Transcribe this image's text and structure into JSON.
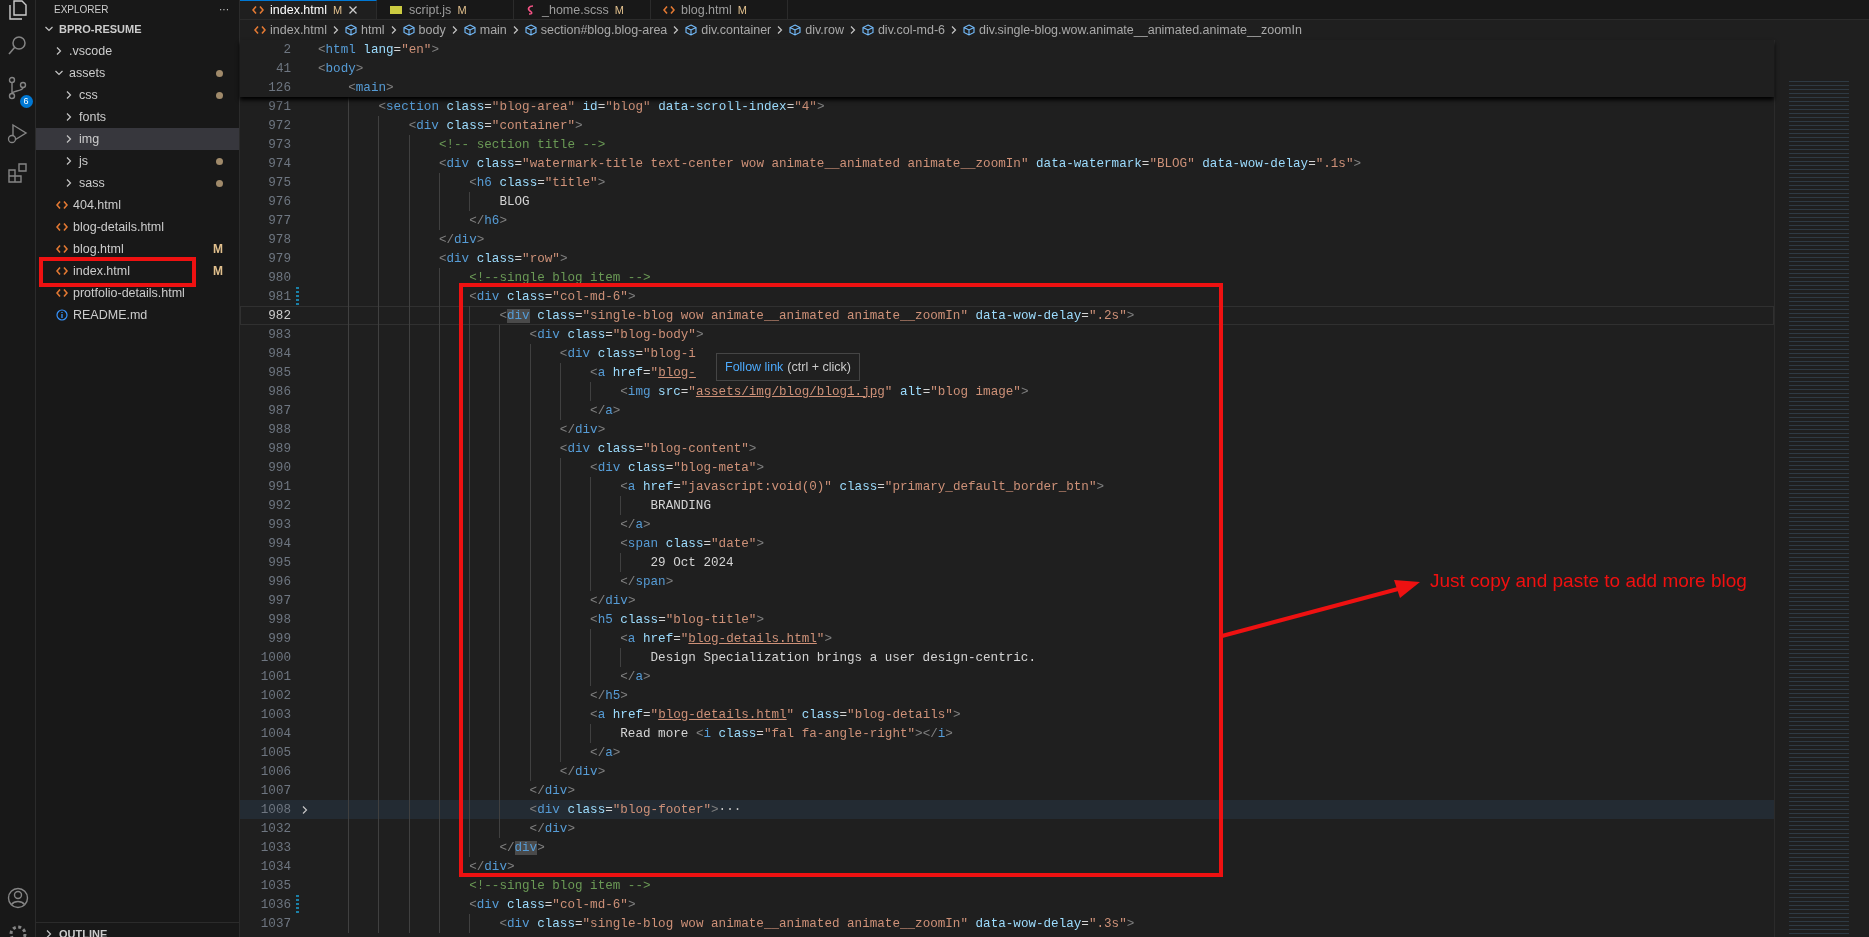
{
  "activity_bar": {
    "source_control_badge": "6"
  },
  "sidebar": {
    "title": "EXPLORER",
    "more": "···",
    "tree": [
      {
        "name": "BPRO-RESUME",
        "kind": "root",
        "expanded": true,
        "selected": false,
        "modified": false,
        "children": [
          {
            "name": ".vscode",
            "kind": "folder",
            "expanded": false,
            "selected": false,
            "modified": false
          },
          {
            "name": "assets",
            "kind": "folder",
            "expanded": true,
            "selected": false,
            "modified": true,
            "children": [
              {
                "name": "css",
                "kind": "folder",
                "expanded": false,
                "selected": false,
                "modified": true
              },
              {
                "name": "fonts",
                "kind": "folder",
                "expanded": false,
                "selected": false,
                "modified": false
              },
              {
                "name": "img",
                "kind": "folder",
                "expanded": false,
                "selected": true,
                "modified": false
              },
              {
                "name": "js",
                "kind": "folder",
                "expanded": false,
                "selected": false,
                "modified": true
              },
              {
                "name": "sass",
                "kind": "folder",
                "expanded": false,
                "selected": false,
                "modified": true
              }
            ]
          },
          {
            "name": "404.html",
            "kind": "html",
            "selected": false,
            "modified": false
          },
          {
            "name": "blog-details.html",
            "kind": "html",
            "selected": false,
            "modified": false
          },
          {
            "name": "blog.html",
            "kind": "html",
            "selected": false,
            "modified": true,
            "badge": "M"
          },
          {
            "name": "index.html",
            "kind": "html",
            "selected": false,
            "modified": true,
            "badge": "M"
          },
          {
            "name": "protfolio-details.html",
            "kind": "html",
            "selected": false,
            "modified": false
          },
          {
            "name": "README.md",
            "kind": "info",
            "selected": false,
            "modified": false
          }
        ]
      }
    ],
    "outline": {
      "label": "OUTLINE",
      "expanded": false
    }
  },
  "tabs": [
    {
      "label": "index.html",
      "badge": "M",
      "kind": "html",
      "selected": true
    },
    {
      "label": "script.js",
      "badge": "M",
      "kind": "js",
      "selected": false
    },
    {
      "label": "_home.scss",
      "badge": "M",
      "kind": "scss",
      "selected": false
    },
    {
      "label": "blog.html",
      "badge": "M",
      "kind": "html",
      "selected": false
    }
  ],
  "breadcrumbs": [
    {
      "label": "index.html",
      "kind": "file"
    },
    {
      "label": "html",
      "kind": "element"
    },
    {
      "label": "body",
      "kind": "element"
    },
    {
      "label": "main",
      "kind": "element"
    },
    {
      "label": "section#blog.blog-area",
      "kind": "element"
    },
    {
      "label": "div.container",
      "kind": "element"
    },
    {
      "label": "div.row",
      "kind": "element"
    },
    {
      "label": "div.col-md-6",
      "kind": "element"
    },
    {
      "label": "div.single-blog.wow.animate__animated.animate__zoomIn",
      "kind": "element"
    }
  ],
  "sticky_lines": [
    {
      "number": "2",
      "tokens": [
        {
          "kind": "tag",
          "text": "<html"
        },
        {
          "kind": "attr",
          "text": " lang="
        },
        {
          "kind": "string",
          "text": "\"en\""
        },
        {
          "kind": "tag",
          "text": ">"
        }
      ]
    },
    {
      "number": "41",
      "tokens": [
        {
          "kind": "tag",
          "text": "<body>"
        }
      ]
    },
    {
      "number": "126",
      "tokens": [
        {
          "kind": "tag",
          "text": "    <main>"
        }
      ]
    }
  ],
  "lines": [
    {
      "number": "971",
      "kind": "plain",
      "tokens": [
        {
          "kind": "tag",
          "text": "        <section"
        },
        {
          "kind": "attr",
          "text": " class="
        },
        {
          "kind": "string",
          "text": "\"blog-area\""
        },
        {
          "kind": "attr",
          "text": " id="
        },
        {
          "kind": "string",
          "text": "\"blog\""
        },
        {
          "kind": "attr",
          "text": " data-scroll-index="
        },
        {
          "kind": "string",
          "text": "\"4\""
        },
        {
          "kind": "tag",
          "text": ">"
        }
      ]
    },
    {
      "number": "972",
      "kind": "plain",
      "tokens": [
        {
          "kind": "tag",
          "text": "            <div"
        },
        {
          "kind": "attr",
          "text": " class="
        },
        {
          "kind": "string",
          "text": "\"container\""
        },
        {
          "kind": "tag",
          "text": ">"
        }
      ]
    },
    {
      "number": "973",
      "kind": "plain",
      "tokens": [
        {
          "kind": "comment",
          "text": "                <!-- section title -->"
        }
      ]
    },
    {
      "number": "974",
      "kind": "plain",
      "tokens": [
        {
          "kind": "tag",
          "text": "                <div"
        },
        {
          "kind": "attr",
          "text": " class="
        },
        {
          "kind": "string",
          "text": "\"watermark-title text-center wow animate__animated animate__zoomIn\""
        },
        {
          "kind": "attr",
          "text": " data-watermark="
        },
        {
          "kind": "string",
          "text": "\"BLOG\""
        },
        {
          "kind": "attr",
          "text": " data-wow-delay="
        },
        {
          "kind": "string",
          "text": "\".1s\""
        },
        {
          "kind": "tag",
          "text": ">"
        }
      ]
    },
    {
      "number": "975",
      "kind": "plain",
      "tokens": [
        {
          "kind": "tag",
          "text": "                    <h6"
        },
        {
          "kind": "attr",
          "text": " class="
        },
        {
          "kind": "string",
          "text": "\"title\""
        },
        {
          "kind": "tag",
          "text": ">"
        }
      ]
    },
    {
      "number": "976",
      "kind": "plain",
      "tokens": [
        {
          "kind": "text",
          "text": "                        BLOG"
        }
      ]
    },
    {
      "number": "977",
      "kind": "plain",
      "tokens": [
        {
          "kind": "tag",
          "text": "                    </h6>"
        }
      ]
    },
    {
      "number": "978",
      "kind": "plain",
      "tokens": [
        {
          "kind": "tag",
          "text": "                </div>"
        }
      ]
    },
    {
      "number": "979",
      "kind": "plain",
      "tokens": [
        {
          "kind": "tag",
          "text": "                <div"
        },
        {
          "kind": "attr",
          "text": " class="
        },
        {
          "kind": "string",
          "text": "\"row\""
        },
        {
          "kind": "tag",
          "text": ">"
        }
      ]
    },
    {
      "number": "980",
      "kind": "plain",
      "tokens": [
        {
          "kind": "comment",
          "text": "                    <!--single blog item -->"
        }
      ]
    },
    {
      "number": "981",
      "kind": "modified",
      "tokens": [
        {
          "kind": "tag",
          "text": "                    <div"
        },
        {
          "kind": "attr",
          "text": " class="
        },
        {
          "kind": "string",
          "text": "\"col-md-6\""
        },
        {
          "kind": "tag",
          "text": ">"
        }
      ]
    },
    {
      "number": "982",
      "kind": "current",
      "tokens": [
        {
          "kind": "tag",
          "text": "                        <"
        },
        {
          "kind": "match",
          "text": "div"
        },
        {
          "kind": "attr",
          "text": " class="
        },
        {
          "kind": "string",
          "text": "\"single-blog wow animate__animated animate__zoomIn\""
        },
        {
          "kind": "attr",
          "text": " data-wow-delay="
        },
        {
          "kind": "string",
          "text": "\".2s\""
        },
        {
          "kind": "tag",
          "text": ">"
        }
      ]
    },
    {
      "number": "983",
      "kind": "plain",
      "tokens": [
        {
          "kind": "tag",
          "text": "                            <div"
        },
        {
          "kind": "attr",
          "text": " class="
        },
        {
          "kind": "string",
          "text": "\"blog-body\""
        },
        {
          "kind": "tag",
          "text": ">"
        }
      ]
    },
    {
      "number": "984",
      "kind": "plain",
      "tokens": [
        {
          "kind": "tag",
          "text": "                                <div"
        },
        {
          "kind": "attr",
          "text": " class="
        },
        {
          "kind": "string",
          "text": "\"blog-i"
        }
      ]
    },
    {
      "number": "985",
      "kind": "plain",
      "tokens": [
        {
          "kind": "tag",
          "text": "                                    <a"
        },
        {
          "kind": "attr",
          "text": " href="
        },
        {
          "kind": "string",
          "text": "\""
        },
        {
          "kind": "link",
          "text": "blog-"
        }
      ]
    },
    {
      "number": "986",
      "kind": "plain",
      "tokens": [
        {
          "kind": "tag",
          "text": "                                        <img"
        },
        {
          "kind": "attr",
          "text": " src="
        },
        {
          "kind": "string",
          "text": "\""
        },
        {
          "kind": "link",
          "text": "assets/img/blog/blog1.jpg"
        },
        {
          "kind": "string",
          "text": "\""
        },
        {
          "kind": "attr",
          "text": " alt="
        },
        {
          "kind": "string",
          "text": "\"blog image\""
        },
        {
          "kind": "tag",
          "text": ">"
        }
      ]
    },
    {
      "number": "987",
      "kind": "plain",
      "tokens": [
        {
          "kind": "tag",
          "text": "                                    </a>"
        }
      ]
    },
    {
      "number": "988",
      "kind": "plain",
      "tokens": [
        {
          "kind": "tag",
          "text": "                                </div>"
        }
      ]
    },
    {
      "number": "989",
      "kind": "plain",
      "tokens": [
        {
          "kind": "tag",
          "text": "                                <div"
        },
        {
          "kind": "attr",
          "text": " class="
        },
        {
          "kind": "string",
          "text": "\"blog-content\""
        },
        {
          "kind": "tag",
          "text": ">"
        }
      ]
    },
    {
      "number": "990",
      "kind": "plain",
      "tokens": [
        {
          "kind": "tag",
          "text": "                                    <div"
        },
        {
          "kind": "attr",
          "text": " class="
        },
        {
          "kind": "string",
          "text": "\"blog-meta\""
        },
        {
          "kind": "tag",
          "text": ">"
        }
      ]
    },
    {
      "number": "991",
      "kind": "plain",
      "tokens": [
        {
          "kind": "tag",
          "text": "                                        <a"
        },
        {
          "kind": "attr",
          "text": " href="
        },
        {
          "kind": "string",
          "text": "\"javascript:void(0)\""
        },
        {
          "kind": "attr",
          "text": " class="
        },
        {
          "kind": "string",
          "text": "\"primary_default_border_btn\""
        },
        {
          "kind": "tag",
          "text": ">"
        }
      ]
    },
    {
      "number": "992",
      "kind": "plain",
      "tokens": [
        {
          "kind": "text",
          "text": "                                            BRANDING"
        }
      ]
    },
    {
      "number": "993",
      "kind": "plain",
      "tokens": [
        {
          "kind": "tag",
          "text": "                                        </a>"
        }
      ]
    },
    {
      "number": "994",
      "kind": "plain",
      "tokens": [
        {
          "kind": "tag",
          "text": "                                        <span"
        },
        {
          "kind": "attr",
          "text": " class="
        },
        {
          "kind": "string",
          "text": "\"date\""
        },
        {
          "kind": "tag",
          "text": ">"
        }
      ]
    },
    {
      "number": "995",
      "kind": "plain",
      "tokens": [
        {
          "kind": "text",
          "text": "                                            29 Oct 2024"
        }
      ]
    },
    {
      "number": "996",
      "kind": "plain",
      "tokens": [
        {
          "kind": "tag",
          "text": "                                        </span>"
        }
      ]
    },
    {
      "number": "997",
      "kind": "plain",
      "tokens": [
        {
          "kind": "tag",
          "text": "                                    </div>"
        }
      ]
    },
    {
      "number": "998",
      "kind": "plain",
      "tokens": [
        {
          "kind": "tag",
          "text": "                                    <h5"
        },
        {
          "kind": "attr",
          "text": " class="
        },
        {
          "kind": "string",
          "text": "\"blog-title\""
        },
        {
          "kind": "tag",
          "text": ">"
        }
      ]
    },
    {
      "number": "999",
      "kind": "plain",
      "tokens": [
        {
          "kind": "tag",
          "text": "                                        <a"
        },
        {
          "kind": "attr",
          "text": " href="
        },
        {
          "kind": "string",
          "text": "\""
        },
        {
          "kind": "link",
          "text": "blog-details.html"
        },
        {
          "kind": "string",
          "text": "\""
        },
        {
          "kind": "tag",
          "text": ">"
        }
      ]
    },
    {
      "number": "1000",
      "kind": "plain",
      "tokens": [
        {
          "kind": "text",
          "text": "                                            Design Specialization brings a user design-centric."
        }
      ]
    },
    {
      "number": "1001",
      "kind": "plain",
      "tokens": [
        {
          "kind": "tag",
          "text": "                                        </a>"
        }
      ]
    },
    {
      "number": "1002",
      "kind": "plain",
      "tokens": [
        {
          "kind": "tag",
          "text": "                                    </h5>"
        }
      ]
    },
    {
      "number": "1003",
      "kind": "plain",
      "tokens": [
        {
          "kind": "tag",
          "text": "                                    <a"
        },
        {
          "kind": "attr",
          "text": " href="
        },
        {
          "kind": "string",
          "text": "\""
        },
        {
          "kind": "link",
          "text": "blog-details.html"
        },
        {
          "kind": "string",
          "text": "\""
        },
        {
          "kind": "attr",
          "text": " class="
        },
        {
          "kind": "string",
          "text": "\"blog-details\""
        },
        {
          "kind": "tag",
          "text": ">"
        }
      ]
    },
    {
      "number": "1004",
      "kind": "plain",
      "tokens": [
        {
          "kind": "text",
          "text": "                                        Read more "
        },
        {
          "kind": "tag",
          "text": "<i"
        },
        {
          "kind": "attr",
          "text": " class="
        },
        {
          "kind": "string",
          "text": "\"fal fa-angle-right\""
        },
        {
          "kind": "tag",
          "text": "></i>"
        }
      ]
    },
    {
      "number": "1005",
      "kind": "plain",
      "tokens": [
        {
          "kind": "tag",
          "text": "                                    </a>"
        }
      ]
    },
    {
      "number": "1006",
      "kind": "plain",
      "tokens": [
        {
          "kind": "tag",
          "text": "                                </div>"
        }
      ]
    },
    {
      "number": "1007",
      "kind": "plain",
      "tokens": [
        {
          "kind": "tag",
          "text": "                            </div>"
        }
      ]
    },
    {
      "number": "1008",
      "kind": "folded",
      "tokens": [
        {
          "kind": "tag",
          "text": "                            <div"
        },
        {
          "kind": "attr",
          "text": " class="
        },
        {
          "kind": "string",
          "text": "\"blog-footer\""
        },
        {
          "kind": "tag",
          "text": ">"
        },
        {
          "kind": "fold",
          "text": "···"
        }
      ]
    },
    {
      "number": "1032",
      "kind": "plain",
      "tokens": [
        {
          "kind": "tag",
          "text": "                            </div>"
        }
      ]
    },
    {
      "number": "1033",
      "kind": "plain",
      "tokens": [
        {
          "kind": "tag",
          "text": "                        </"
        },
        {
          "kind": "match",
          "text": "div"
        },
        {
          "kind": "tag",
          "text": ">"
        }
      ]
    },
    {
      "number": "1034",
      "kind": "plain",
      "tokens": [
        {
          "kind": "tag",
          "text": "                    </div>"
        }
      ]
    },
    {
      "number": "1035",
      "kind": "plain",
      "tokens": [
        {
          "kind": "comment",
          "text": "                    <!--single blog item -->"
        }
      ]
    },
    {
      "number": "1036",
      "kind": "modified",
      "tokens": [
        {
          "kind": "tag",
          "text": "                    <div"
        },
        {
          "kind": "attr",
          "text": " class="
        },
        {
          "kind": "string",
          "text": "\"col-md-6\""
        },
        {
          "kind": "tag",
          "text": ">"
        }
      ]
    },
    {
      "number": "1037",
      "kind": "plain",
      "tokens": [
        {
          "kind": "tag",
          "text": "                        <div"
        },
        {
          "kind": "attr",
          "text": " class="
        },
        {
          "kind": "string",
          "text": "\"single-blog wow animate__animated animate__zoomIn\""
        },
        {
          "kind": "attr",
          "text": " data-wow-delay="
        },
        {
          "kind": "string",
          "text": "\".3s\""
        },
        {
          "kind": "tag",
          "text": ">"
        }
      ]
    }
  ],
  "tooltip": {
    "link": "Follow link",
    "hint": "(ctrl + click)"
  },
  "annotation": {
    "text": "Just copy and paste to add more blog"
  }
}
